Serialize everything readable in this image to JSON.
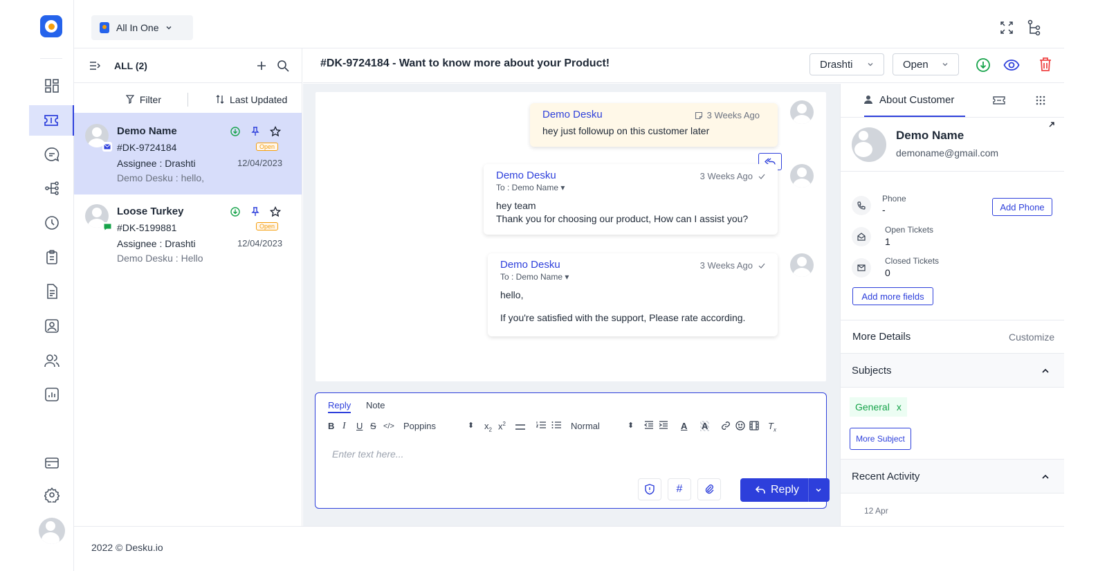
{
  "channel": {
    "label": "All In One"
  },
  "list": {
    "heading": "ALL (2)",
    "filter_label": "Filter",
    "sort_label": "Last Updated",
    "tickets": [
      {
        "name": "Demo Name",
        "id": "#DK-9724184",
        "status": "Open",
        "assignee": "Assignee : Drashti",
        "date": "12/04/2023",
        "preview": "Demo Desku : hello,"
      },
      {
        "name": "Loose Turkey",
        "id": "#DK-5199881",
        "status": "Open",
        "assignee": "Assignee : Drashti",
        "date": "12/04/2023",
        "preview": "Demo Desku : Hello"
      }
    ]
  },
  "ticket": {
    "title": "#DK-9724184 - Want to know more about your Product!",
    "assignee_select": "Drashti",
    "status_select": "Open"
  },
  "messages": [
    {
      "author": "Demo Desku",
      "time": "3 Weeks Ago",
      "body": "hey just followup on this customer later"
    },
    {
      "author": "Demo Desku",
      "time": "3 Weeks Ago",
      "to": "To : Demo Name",
      "line1": "hey team",
      "line2": "Thank you for choosing our product, How can I assist you?"
    },
    {
      "author": "Demo Desku",
      "time": "3 Weeks Ago",
      "to": "To : Demo Name",
      "line1": "hello,",
      "line2": "If you're satisfied with the support, Please rate according."
    }
  ],
  "editor": {
    "tab_reply": "Reply",
    "tab_note": "Note",
    "font": "Poppins",
    "size": "Normal",
    "placeholder": "Enter text here...",
    "reply_label": "Reply"
  },
  "customer": {
    "tab_label": "About Customer",
    "name": "Demo Name",
    "email": "demoname@gmail.com",
    "phone_label": "Phone",
    "phone_value": "-",
    "add_phone": "Add Phone",
    "open_label": "Open Tickets",
    "open_value": "1",
    "closed_label": "Closed Tickets",
    "closed_value": "0",
    "add_fields": "Add more fields",
    "more_details": "More Details",
    "customize": "Customize",
    "subjects": "Subjects",
    "subject_tag": "General",
    "subject_remove": "x",
    "more_subject": "More Subject",
    "recent_activity": "Recent Activity",
    "activity_date": "12 Apr"
  },
  "footer": {
    "text": "2022 © Desku.io"
  },
  "colors": {
    "accent": "#2d3fdb",
    "selected_row": "#d7ddfa",
    "note_bg": "#fff8e8",
    "open_badge": "#f59e0b",
    "delete": "#ef4444",
    "green": "#16a34a"
  }
}
